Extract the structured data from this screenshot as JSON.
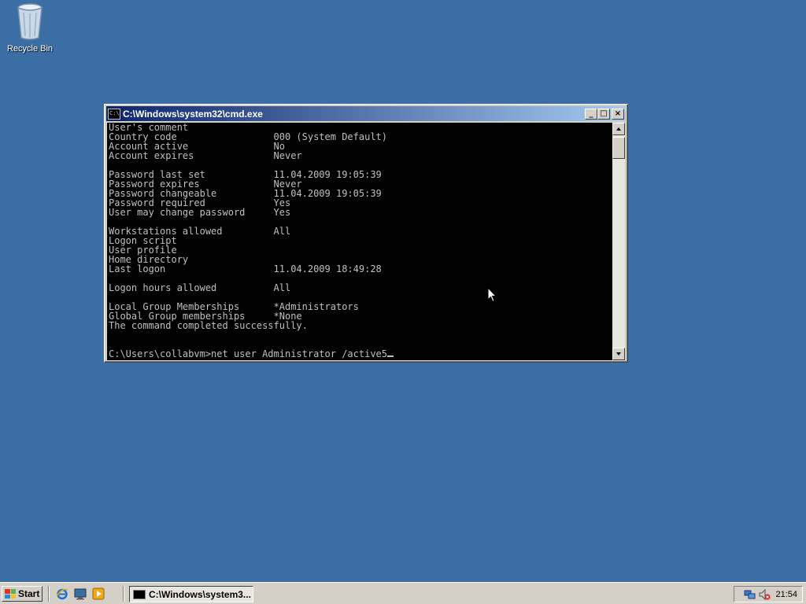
{
  "desktop": {
    "recycle_bin_label": "Recycle Bin"
  },
  "window": {
    "title": "C:\\Windows\\system32\\cmd.exe",
    "min_glyph": "_",
    "max_glyph": "□",
    "close_glyph": "×",
    "console_lines": [
      "User's comment",
      "Country code                 000 (System Default)",
      "Account active               No",
      "Account expires              Never",
      "",
      "Password last set            11.04.2009 19:05:39",
      "Password expires             Never",
      "Password changeable          11.04.2009 19:05:39",
      "Password required            Yes",
      "User may change password     Yes",
      "",
      "Workstations allowed         All",
      "Logon script",
      "User profile",
      "Home directory",
      "Last logon                   11.04.2009 18:49:28",
      "",
      "Logon hours allowed          All",
      "",
      "Local Group Memberships      *Administrators",
      "Global Group memberships     *None",
      "The command completed successfully.",
      "",
      ""
    ],
    "prompt_line": "C:\\Users\\collabvm>net user Administrator /active5"
  },
  "taskbar": {
    "start_label": "Start",
    "task_label": "C:\\Windows\\system3...",
    "clock": "21:54"
  },
  "colors": {
    "desktop": "#3a6ea5",
    "title_start": "#0a246a",
    "title_end": "#a6caf0",
    "console_bg": "#000000",
    "console_fg": "#c0c0c0"
  }
}
